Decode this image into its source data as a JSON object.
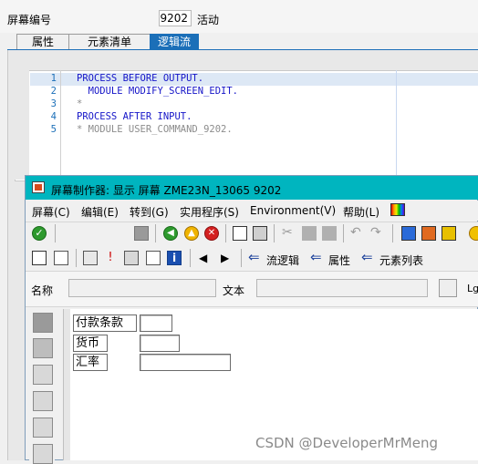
{
  "header": {
    "screen_number_label": "屏幕编号",
    "screen_number": "9202",
    "status": "活动"
  },
  "tabs": [
    {
      "label": "属性"
    },
    {
      "label": "元素清单"
    },
    {
      "label": "逻辑流",
      "active": true
    }
  ],
  "editor": {
    "lines": [
      {
        "no": "1",
        "text": "PROCESS BEFORE OUTPUT."
      },
      {
        "no": "2",
        "text": "  MODULE MODIFY_SCREEN_EDIT."
      },
      {
        "no": "3",
        "text": "*"
      },
      {
        "no": "4",
        "text": "PROCESS AFTER INPUT."
      },
      {
        "no": "5",
        "text": "* MODULE USER_COMMAND_9202."
      }
    ]
  },
  "window": {
    "title": "屏幕制作器:  显示 屏幕 ZME23N_13065 9202",
    "menu": [
      "屏幕(C)",
      "编辑(E)",
      "转到(G)",
      "实用程序(S)",
      "Environment(V)",
      "帮助(L)"
    ],
    "toolbar2": {
      "flow_logic_label": "流逻辑",
      "attributes_label": "属性",
      "element_list_label": "元素列表"
    },
    "name_label": "名称",
    "text_label": "文本",
    "lg_label": "Lg"
  },
  "canvas_fields": [
    {
      "label": "付款条款"
    },
    {
      "label": "货币"
    },
    {
      "label": "汇率"
    }
  ],
  "watermark": "CSDN @DeveloperMrMeng",
  "colors": {
    "accent": "#1b6fb8",
    "title_bar": "#00b5bf",
    "keyword": "#1515c8",
    "comment": "#8c8c8c"
  }
}
